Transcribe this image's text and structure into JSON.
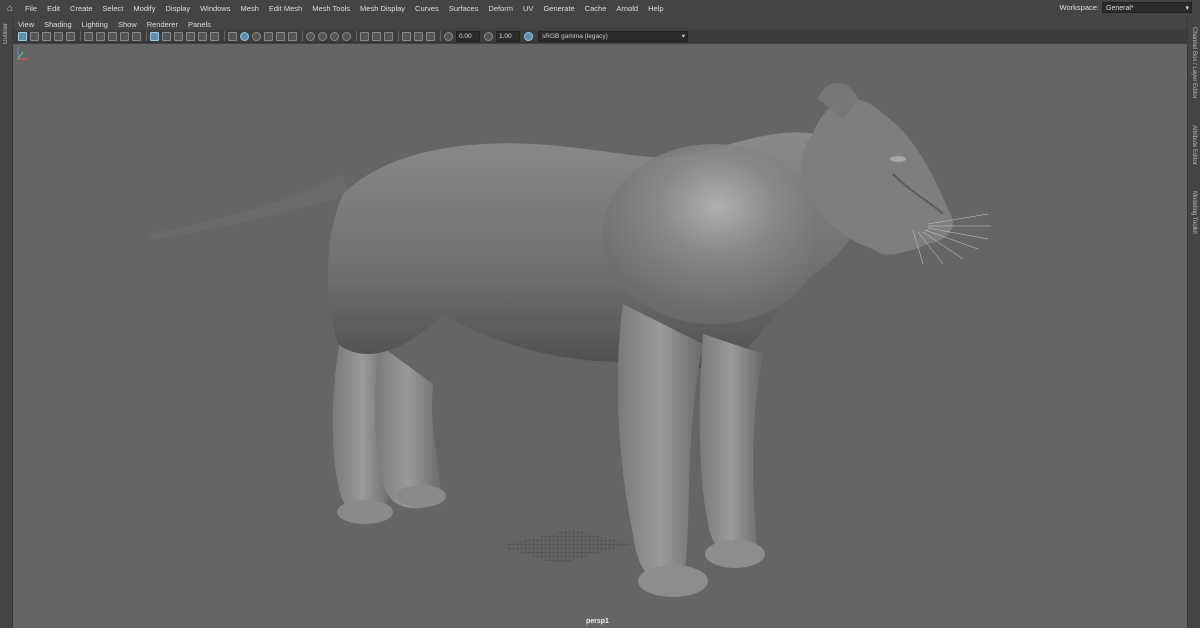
{
  "menubar": {
    "items": [
      "File",
      "Edit",
      "Create",
      "Select",
      "Modify",
      "Display",
      "Windows",
      "Mesh",
      "Edit Mesh",
      "Mesh Tools",
      "Mesh Display",
      "Curves",
      "Surfaces",
      "Deform",
      "UV",
      "Generate",
      "Cache",
      "Arnold",
      "Help"
    ]
  },
  "workspace": {
    "label": "Workspace:",
    "value": "General*"
  },
  "panel_menu": {
    "items": [
      "View",
      "Shading",
      "Lighting",
      "Show",
      "Renderer",
      "Panels"
    ]
  },
  "toolbar": {
    "exposure": "0.00",
    "gamma": "1.00",
    "color_space": "sRGB gamma (legacy)"
  },
  "left_panel": {
    "label": "Outliner"
  },
  "right_panel": {
    "labels": [
      "Channel Box / Layer Editor",
      "Attribute Editor",
      "Modeling Toolkit"
    ]
  },
  "viewport": {
    "camera": "persp1",
    "background_color": "#656565"
  },
  "icons": {
    "home": "home-icon",
    "toolbar": [
      "select-camera-icon",
      "lock-camera-icon",
      "camera-attributes-icon",
      "bookmark-icon",
      "image-plane-icon",
      "grid-icon",
      "film-gate-icon",
      "resolution-gate-icon",
      "gate-mask-icon",
      "field-chart-icon",
      "safe-action-icon",
      "safe-title-icon",
      "wireframe-icon",
      "smooth-shade-icon",
      "use-default-material-icon",
      "wireframe-on-shaded-icon",
      "xray-icon",
      "xray-joints-icon",
      "xray-components-icon",
      "textured-icon",
      "lights-icon",
      "shadows-icon",
      "screen-ao-icon",
      "motion-blur-icon",
      "anti-aliasing-icon",
      "dof-icon",
      "isolate-select-icon",
      "exposure-icon",
      "gamma-icon",
      "color-management-icon"
    ]
  }
}
